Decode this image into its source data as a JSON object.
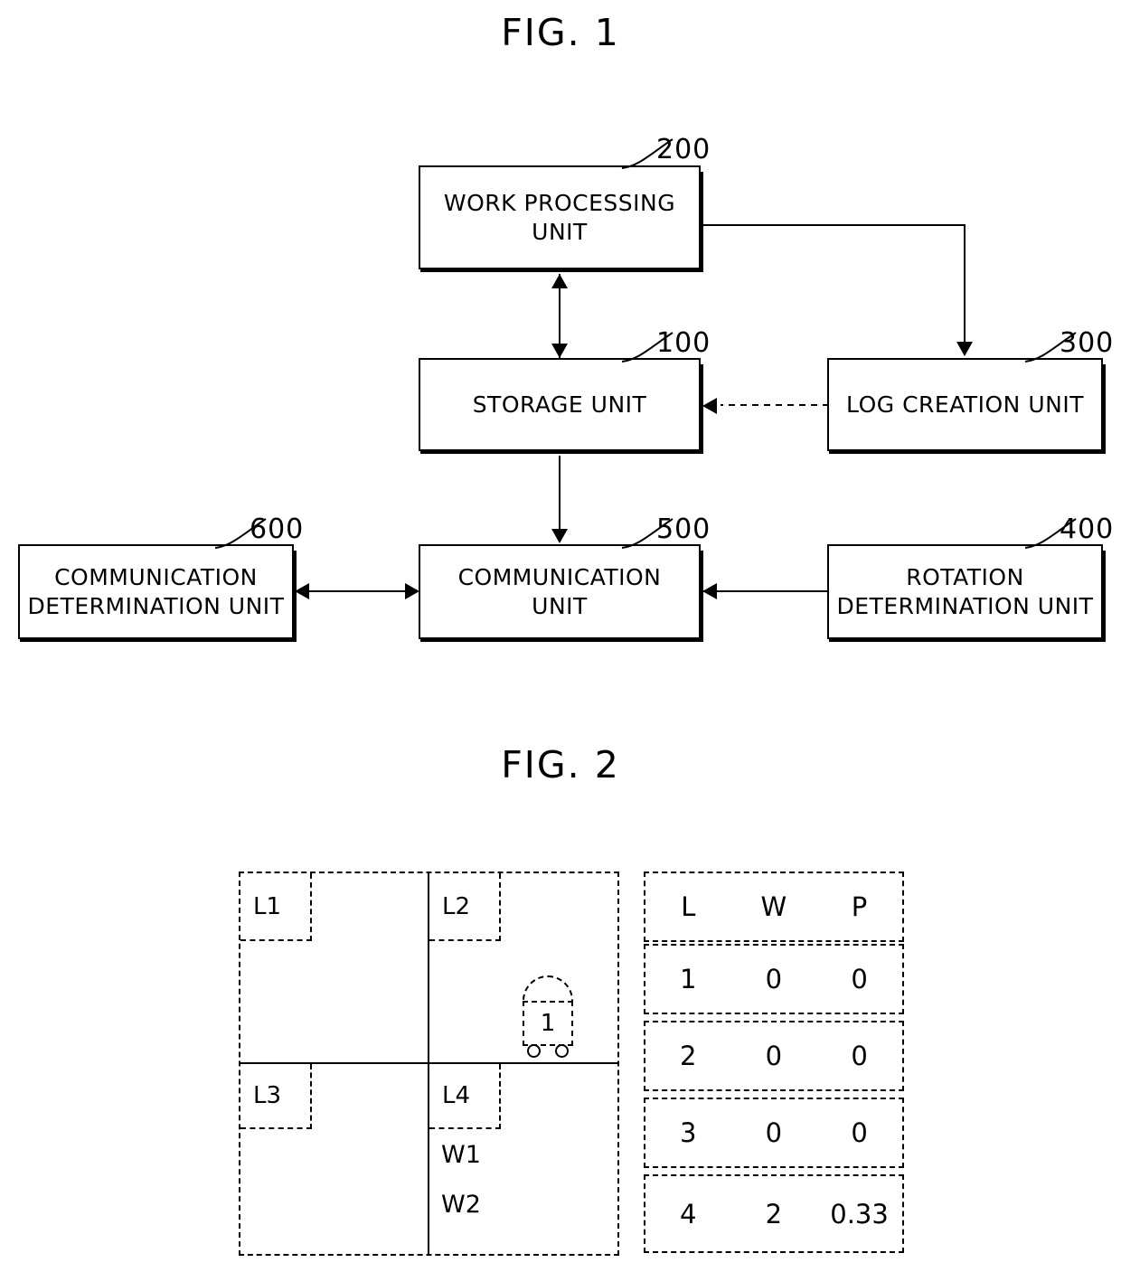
{
  "figures": {
    "fig1": {
      "title": "FIG. 1",
      "blocks": [
        {
          "id": "work_processing",
          "label_line1": "WORK PROCESSING",
          "label_line2": "UNIT",
          "ref": "200"
        },
        {
          "id": "storage",
          "label_line1": "STORAGE UNIT",
          "label_line2": "",
          "ref": "100"
        },
        {
          "id": "log_creation",
          "label_line1": "LOG CREATION UNIT",
          "label_line2": "",
          "ref": "300"
        },
        {
          "id": "communication_determination",
          "label_line1": "COMMUNICATION",
          "label_line2": "DETERMINATION UNIT",
          "ref": "600"
        },
        {
          "id": "communication",
          "label_line1": "COMMUNICATION",
          "label_line2": "UNIT",
          "ref": "500"
        },
        {
          "id": "rotation_determination",
          "label_line1": "ROTATION",
          "label_line2": "DETERMINATION UNIT",
          "ref": "400"
        }
      ]
    },
    "fig2": {
      "title": "FIG. 2",
      "grid_cells": [
        {
          "id": "l1",
          "label": "L1"
        },
        {
          "id": "l2",
          "label": "L2"
        },
        {
          "id": "l3",
          "label": "L3"
        },
        {
          "id": "l4",
          "label": "L4"
        }
      ],
      "work_labels": [
        {
          "id": "w1",
          "label": "W1"
        },
        {
          "id": "w2",
          "label": "W2"
        }
      ],
      "robot": {
        "id": "robot-1",
        "label": "1"
      },
      "table": {
        "headers": [
          "L",
          "W",
          "P"
        ],
        "rows": [
          [
            "1",
            "0",
            "0"
          ],
          [
            "2",
            "0",
            "0"
          ],
          [
            "3",
            "0",
            "0"
          ],
          [
            "4",
            "2",
            "0.33"
          ]
        ]
      }
    }
  },
  "colors": {
    "line": "#000000",
    "background": "#ffffff"
  }
}
